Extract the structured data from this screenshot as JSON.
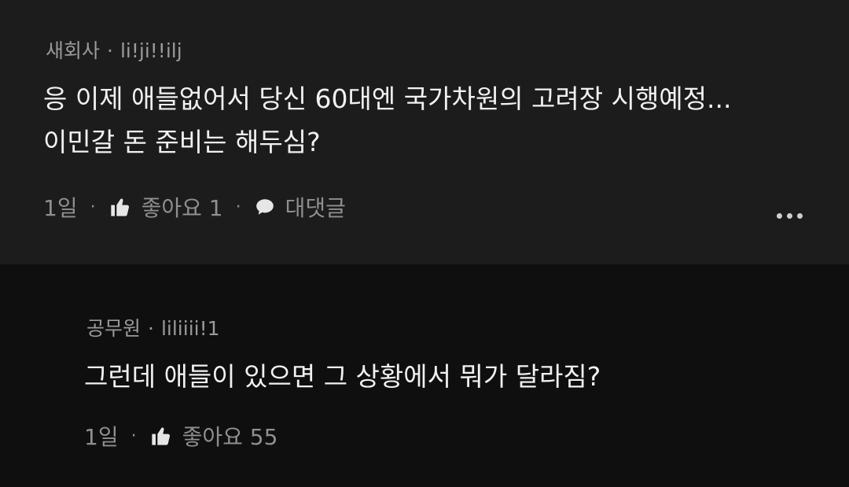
{
  "comments": [
    {
      "author": "새회사",
      "handle": "li!ji!!ilj",
      "lines": [
        "응 이제 애들없어서 당신 60대엔 국가차원의 고려장 시행예정...",
        "이민갈 돈 준비는 해두심?"
      ],
      "time": "1일",
      "like_label": "좋아요 1",
      "reply_label": "대댓글"
    },
    {
      "author": "공무원",
      "handle": "liliiii!1",
      "lines": [
        "그런데 애들이 있으면 그 상황에서 뭐가 달라짐?"
      ],
      "time": "1일",
      "like_label": "좋아요 55"
    }
  ],
  "icons": {
    "like": "thumbs-up-icon",
    "reply": "speech-bubble-icon",
    "more": "more-horizontal-icon"
  },
  "colors": {
    "first_comment_bg": "#1c1c1c",
    "page_bg": "#0f0f0f"
  }
}
